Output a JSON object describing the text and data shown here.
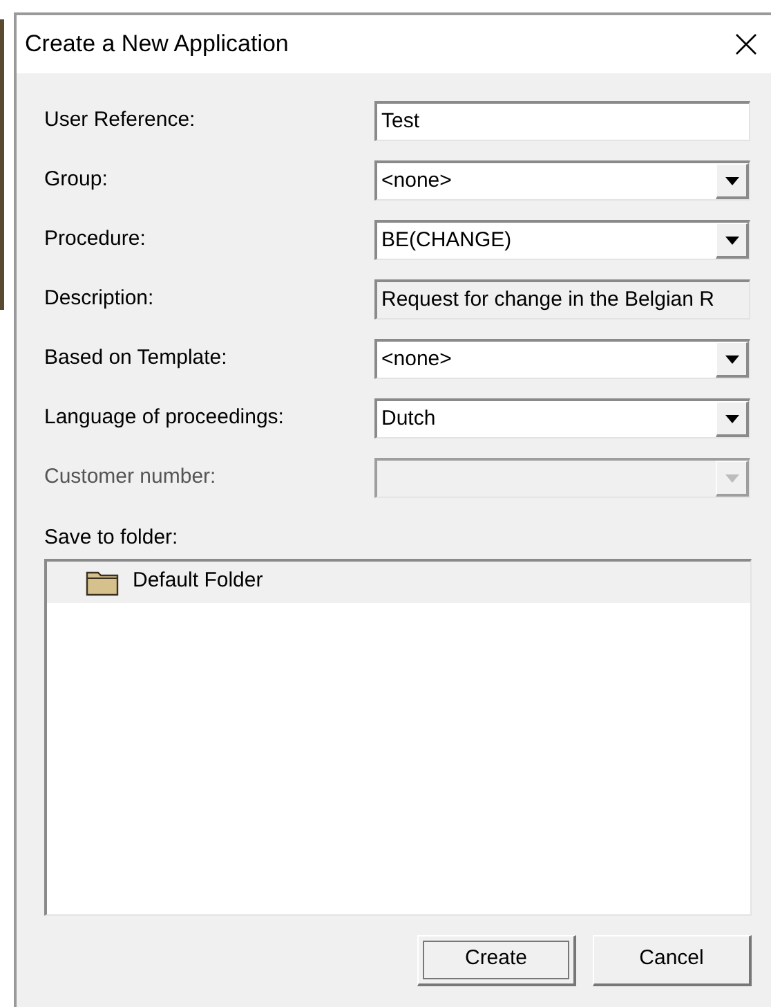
{
  "window": {
    "title": "Create a New Application"
  },
  "fields": [
    {
      "label": "User Reference:",
      "kind": "text",
      "value": "Test",
      "disabled": false
    },
    {
      "label": "Group:",
      "kind": "combo",
      "value": "<none>",
      "disabled": false
    },
    {
      "label": "Procedure:",
      "kind": "combo",
      "value": "BE(CHANGE)",
      "disabled": false
    },
    {
      "label": "Description:",
      "kind": "readonly",
      "value": "Request for change in the Belgian R",
      "disabled": false
    },
    {
      "label": "Based on Template:",
      "kind": "combo",
      "value": "<none>",
      "disabled": false
    },
    {
      "label": "Language of proceedings:",
      "kind": "combo",
      "value": "Dutch",
      "disabled": false
    },
    {
      "label": "Customer number:",
      "kind": "combo",
      "disabled": true
    }
  ],
  "folders": {
    "label": "Save to folder:",
    "items": [
      {
        "name": "Default Folder",
        "selected": true
      }
    ]
  },
  "buttons": [
    {
      "label": "Create",
      "default": true
    },
    {
      "label": "Cancel",
      "default": false
    }
  ]
}
